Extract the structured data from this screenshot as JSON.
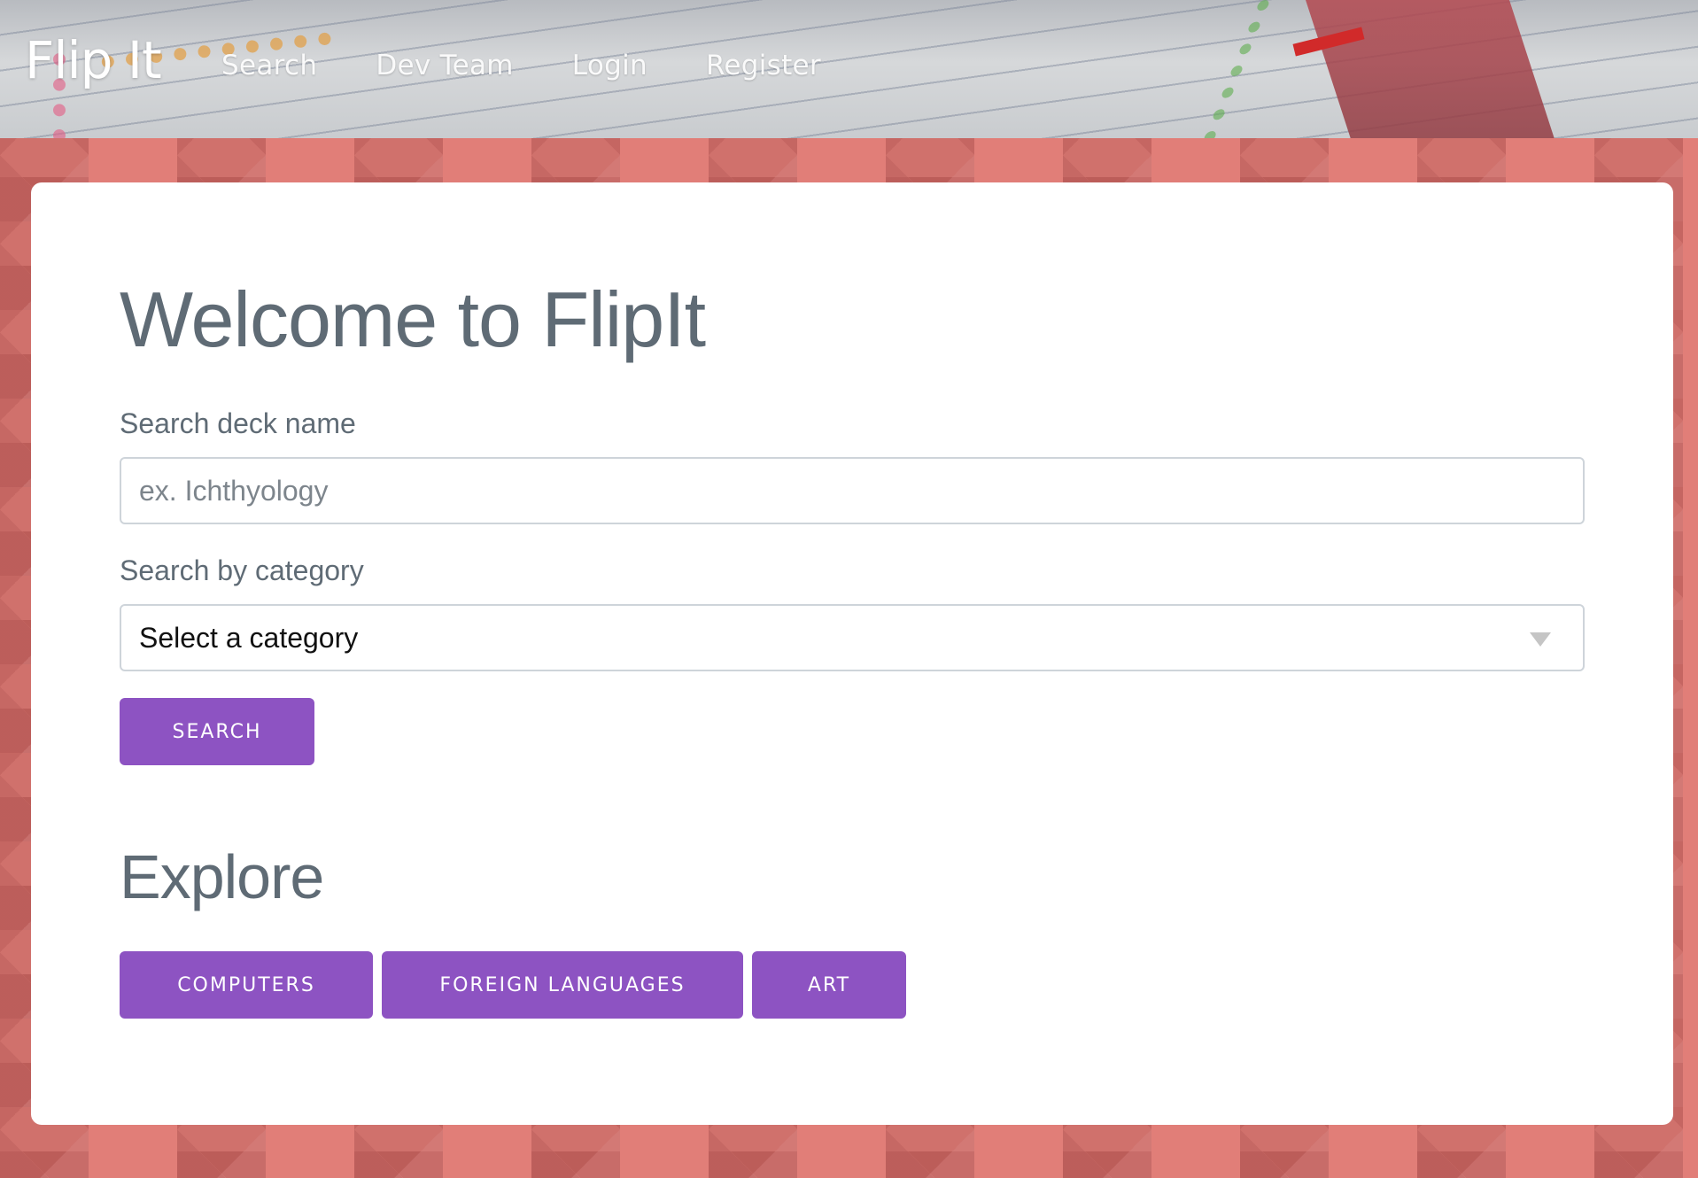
{
  "header": {
    "brand": "Flip It",
    "nav": [
      "Search",
      "Dev Team",
      "Login",
      "Register"
    ]
  },
  "main": {
    "title": "Welcome to FlipIt",
    "deck_label": "Search deck name",
    "deck_placeholder": "ex. Ichthyology",
    "category_label": "Search by category",
    "category_value": "Select a category",
    "search_button": "SEARCH",
    "explore_title": "Explore",
    "explore_buttons": [
      "COMPUTERS",
      "FOREIGN LANGUAGES",
      "ART"
    ]
  },
  "colors": {
    "accent": "#8d53c2",
    "heading": "#5f6b75",
    "background": "#e07a74"
  },
  "icons": {
    "select_caret": "caret-down-icon"
  }
}
